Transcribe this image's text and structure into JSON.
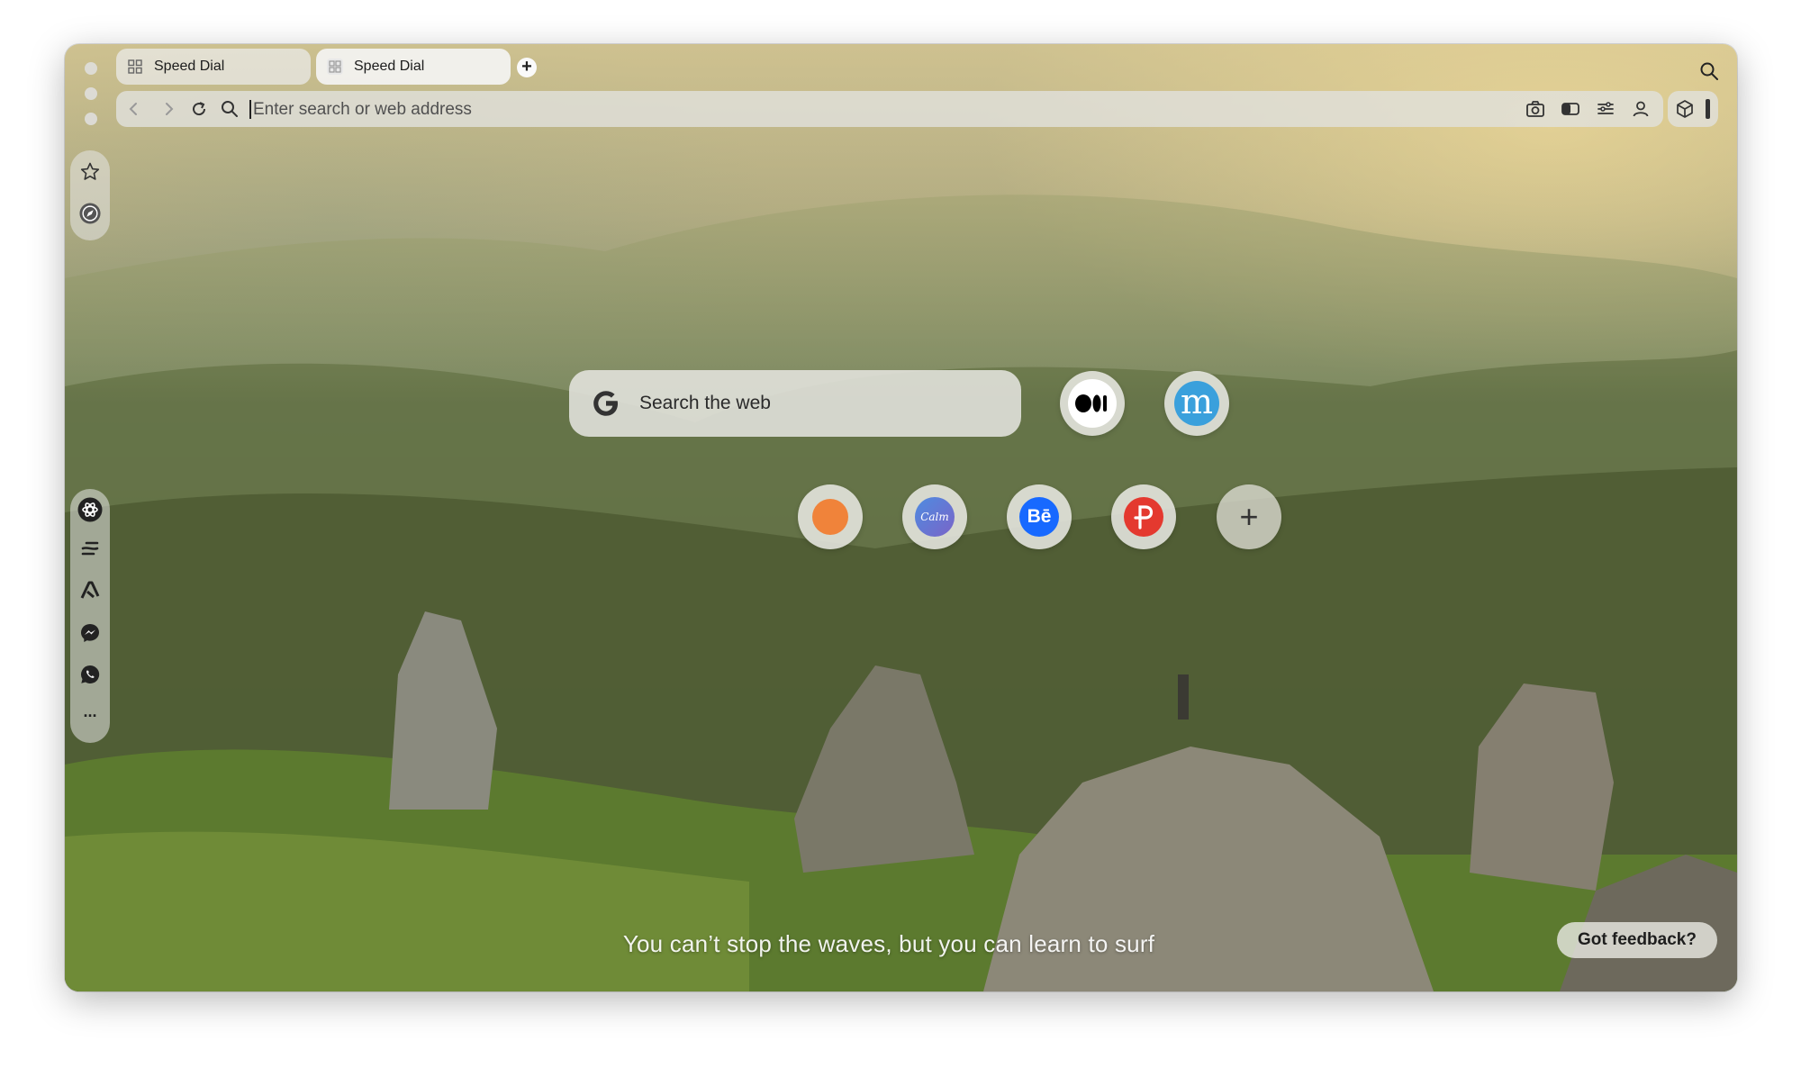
{
  "tabs": [
    {
      "label": "Speed Dial",
      "active": false
    },
    {
      "label": "Speed Dial",
      "active": true
    }
  ],
  "new_tab_label": "+",
  "address_bar": {
    "placeholder": "Enter search or web address"
  },
  "sidebar": {
    "top_items": [
      "star-icon",
      "compass-icon"
    ],
    "app_items": [
      "openai-icon",
      "perplexity-icon",
      "aria-icon",
      "messenger-icon",
      "whatsapp-icon",
      "more-icon"
    ],
    "more_label": "···"
  },
  "speed_dial": {
    "search_label": "Search the web",
    "tiles": [
      {
        "name": "medium",
        "glyph": "●●|",
        "bg": "#ffffff",
        "fg": "#000000"
      },
      {
        "name": "mastodon-m",
        "glyph": "m",
        "bg": "#3aa0dc",
        "fg": "#ffffff"
      },
      {
        "name": "orange-circle",
        "glyph": "",
        "bg": "#f0833a",
        "fg": "#ffffff"
      },
      {
        "name": "calm",
        "glyph": "Calm",
        "bg": "#5f7fd6",
        "fg": "#ffffff"
      },
      {
        "name": "behance",
        "glyph": "Bē",
        "bg": "#1769ff",
        "fg": "#ffffff"
      },
      {
        "name": "producthunt-p",
        "glyph": "P",
        "bg": "#e4392f",
        "fg": "#ffffff"
      }
    ],
    "add_label": "+"
  },
  "quote": "You can’t stop the waves, but you can learn to surf",
  "feedback_label": "Got feedback?"
}
